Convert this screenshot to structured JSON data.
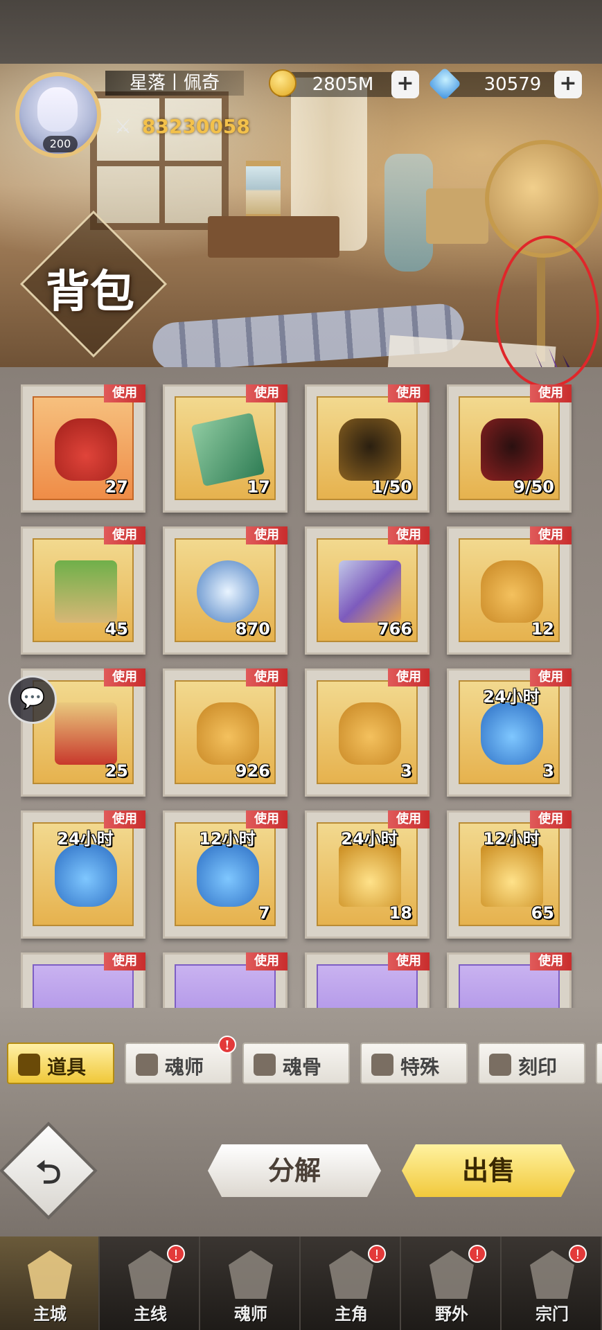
{
  "header": {
    "player_name": "星落丨佩奇",
    "player_level": "200",
    "coins": "2805M",
    "gems": "30579",
    "combat_power": "83230058",
    "page_title": "背包"
  },
  "inventory": {
    "use_label": "使用",
    "rows": [
      [
        {
          "icon": "red-lucky-bag",
          "count": "27",
          "time": ""
        },
        {
          "icon": "mystery-book",
          "count": "17",
          "time": ""
        },
        {
          "icon": "gold-shadow-card",
          "count": "1/50",
          "time": ""
        },
        {
          "icon": "red-shadow-card",
          "count": "9/50",
          "time": ""
        }
      ],
      [
        {
          "icon": "green-treasure-chest",
          "count": "45",
          "time": ""
        },
        {
          "icon": "compass-chest",
          "count": "870",
          "time": ""
        },
        {
          "icon": "crystal-chest",
          "count": "766",
          "time": ""
        },
        {
          "icon": "gold-lucky-bag",
          "count": "12",
          "time": ""
        }
      ],
      [
        {
          "icon": "red-gem-chest",
          "count": "25",
          "time": ""
        },
        {
          "icon": "gold-gem-bag",
          "count": "926",
          "time": ""
        },
        {
          "icon": "purple-gem-bag",
          "count": "3",
          "time": ""
        },
        {
          "icon": "potion-chest",
          "count": "3",
          "time": "24小时"
        }
      ],
      [
        {
          "icon": "potion-chest",
          "count": "",
          "time": "24小时"
        },
        {
          "icon": "potion-chest",
          "count": "7",
          "time": "12小时"
        },
        {
          "icon": "coin-chest",
          "count": "18",
          "time": "24小时"
        },
        {
          "icon": "coin-chest",
          "count": "65",
          "time": "12小时"
        }
      ]
    ]
  },
  "tabs": [
    {
      "label": "道具",
      "active": true,
      "alert": false
    },
    {
      "label": "魂师",
      "active": false,
      "alert": true
    },
    {
      "label": "魂骨",
      "active": false,
      "alert": false
    },
    {
      "label": "特殊",
      "active": false,
      "alert": false
    },
    {
      "label": "刻印",
      "active": false,
      "alert": false
    }
  ],
  "alert_mark": "!",
  "actions": {
    "decompose": "分解",
    "sell": "出售"
  },
  "nav": [
    {
      "label": "主城",
      "active": true,
      "alert": false
    },
    {
      "label": "主线",
      "active": false,
      "alert": true
    },
    {
      "label": "魂师",
      "active": false,
      "alert": false
    },
    {
      "label": "主角",
      "active": false,
      "alert": true
    },
    {
      "label": "野外",
      "active": false,
      "alert": true
    },
    {
      "label": "宗门",
      "active": false,
      "alert": true
    }
  ]
}
